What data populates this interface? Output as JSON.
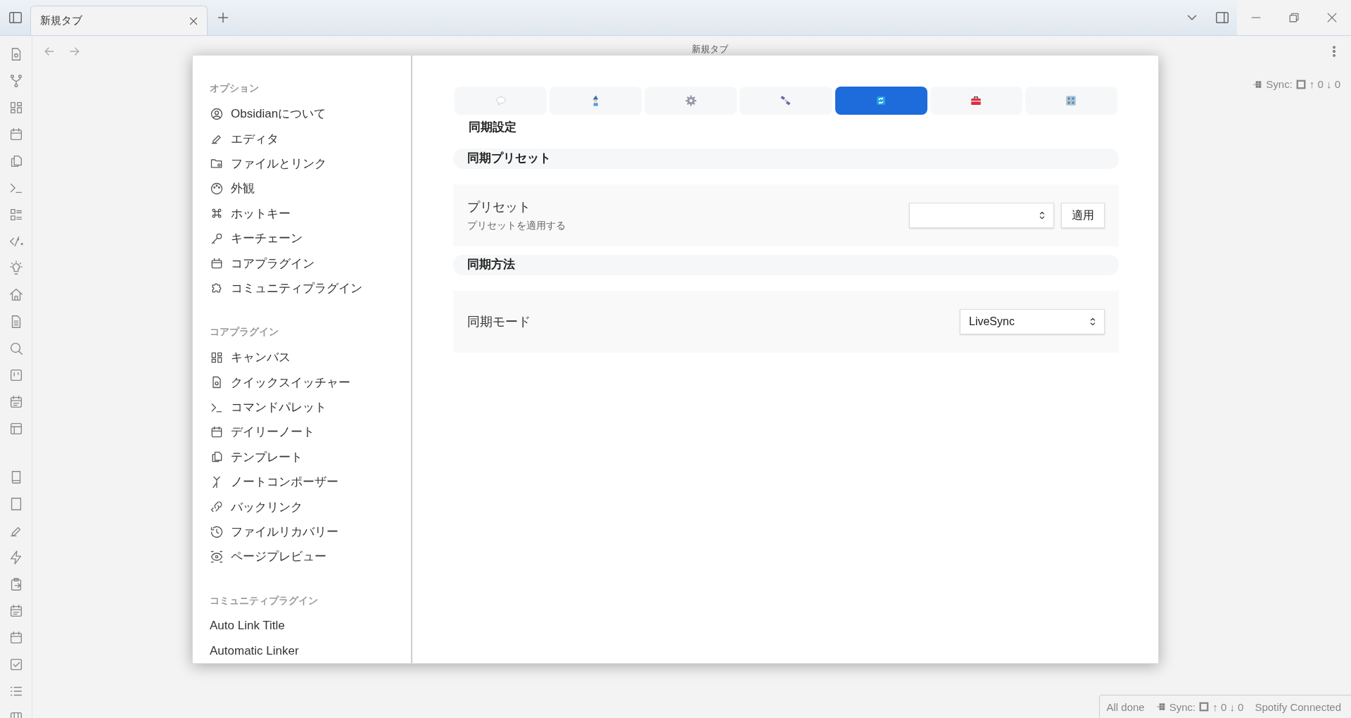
{
  "window": {
    "tabs": [
      {
        "title": "新規タブ",
        "selected": true
      }
    ],
    "view_title": "新規タブ"
  },
  "status_top": {
    "label": "Sync:",
    "counts": "↑ 0 ↓ 0"
  },
  "settings": {
    "sidebar": [
      {
        "heading": "オプション",
        "items": [
          {
            "label": "Obsidianについて"
          },
          {
            "label": "エディタ"
          },
          {
            "label": "ファイルとリンク"
          },
          {
            "label": "外観"
          },
          {
            "label": "ホットキー"
          },
          {
            "label": "キーチェーン"
          },
          {
            "label": "コアプラグイン"
          },
          {
            "label": "コミュニティプラグイン"
          }
        ]
      },
      {
        "heading": "コアプラグイン",
        "items": [
          {
            "label": "キャンバス"
          },
          {
            "label": "クイックスイッチャー"
          },
          {
            "label": "コマンドパレット"
          },
          {
            "label": "デイリーノート"
          },
          {
            "label": "テンプレート"
          },
          {
            "label": "ノートコンポーザー"
          },
          {
            "label": "バックリンク"
          },
          {
            "label": "ファイルリカバリー"
          },
          {
            "label": "ページプレビュー"
          }
        ]
      },
      {
        "heading": "コミュニティプラグイン",
        "items": [
          {
            "label": "Auto Link Title"
          },
          {
            "label": "Automatic Linker"
          }
        ]
      }
    ],
    "tabs": [
      {
        "selected": false
      },
      {
        "selected": false
      },
      {
        "selected": false
      },
      {
        "selected": false
      },
      {
        "selected": true
      },
      {
        "selected": false
      },
      {
        "selected": false
      }
    ],
    "title": "同期設定",
    "sections": [
      {
        "heading": "同期プリセット",
        "settings": [
          {
            "kind": "select_apply",
            "name": "プリセット",
            "description": "プリセットを適用する",
            "button": "適用"
          }
        ]
      },
      {
        "heading": "同期方法",
        "settings": [
          {
            "kind": "select",
            "name": "同期モード",
            "dropdown": "LiveSync"
          }
        ]
      }
    ]
  },
  "status_bar": {
    "items": [
      {
        "kind": "text",
        "text": "All done"
      },
      {
        "kind": "sync",
        "label": "Sync:",
        "counts": "↑ 0 ↓ 0"
      },
      {
        "kind": "text",
        "text": "Spotify Connected"
      }
    ]
  }
}
